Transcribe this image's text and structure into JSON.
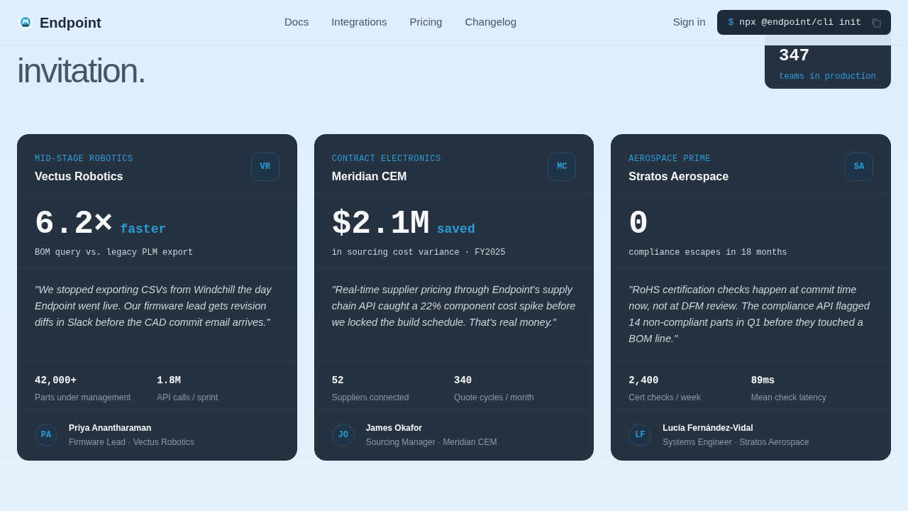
{
  "nav": {
    "brand": "Endpoint",
    "links": [
      "Docs",
      "Integrations",
      "Pricing",
      "Changelog"
    ],
    "sign_in": "Sign in",
    "command": {
      "prompt": "$",
      "text": "npx @endpoint/cli init"
    }
  },
  "hero": {
    "heading_lines": [
      "invitation."
    ],
    "stat": {
      "value": "347",
      "label": "teams in production"
    }
  },
  "cards": [
    {
      "segment": "MID-STAGE ROBOTICS",
      "company": "Vectus Robotics",
      "badge": "VR",
      "metric": "6.2×",
      "metric_unit": "faster",
      "metric_caption": "BOM query vs. legacy PLM export",
      "quote": "\"We stopped exporting CSVs from Windchill the day Endpoint went live. Our firmware lead gets revision diffs in Slack before the CAD commit email arrives.\"",
      "stats": [
        {
          "value": "42,000+",
          "label": "Parts under management"
        },
        {
          "value": "1.8M",
          "label": "API calls / sprint"
        }
      ],
      "person": {
        "initials": "PA",
        "name": "Priya Anantharaman",
        "role": "Firmware Lead · Vectus Robotics"
      }
    },
    {
      "segment": "CONTRACT ELECTRONICS",
      "company": "Meridian CEM",
      "badge": "MC",
      "metric": "$2.1M",
      "metric_unit": "saved",
      "metric_caption": "in sourcing cost variance · FY2025",
      "quote": "\"Real-time supplier pricing through Endpoint's supply chain API caught a 22% component cost spike before we locked the build schedule. That's real money.\"",
      "stats": [
        {
          "value": "52",
          "label": "Suppliers connected"
        },
        {
          "value": "340",
          "label": "Quote cycles / month"
        }
      ],
      "person": {
        "initials": "JO",
        "name": "James Okafor",
        "role": "Sourcing Manager · Meridian CEM"
      }
    },
    {
      "segment": "AEROSPACE PRIME",
      "company": "Stratos Aerospace",
      "badge": "SA",
      "metric": "0",
      "metric_caption": "compliance escapes in 18 months",
      "quote": "\"RoHS certification checks happen at commit time now, not at DFM review. The compliance API flagged 14 non-compliant parts in Q1 before they touched a BOM line.\"",
      "stats": [
        {
          "value": "2,400",
          "label": "Cert checks / week"
        },
        {
          "value": "89ms",
          "label": "Mean check latency"
        }
      ],
      "person": {
        "initials": "LF",
        "name": "Lucía Fernández-Vidal",
        "role": "Systems Engineer · Stratos Aerospace"
      }
    }
  ]
}
